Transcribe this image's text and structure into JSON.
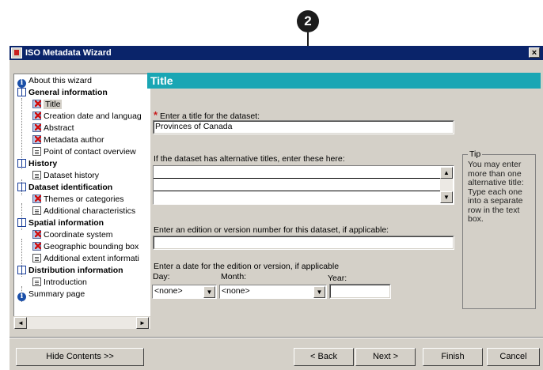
{
  "callout": {
    "number": "2"
  },
  "window": {
    "title": "ISO Metadata Wizard",
    "close_glyph": "×"
  },
  "tree": {
    "items": [
      {
        "label": "About this wizard",
        "level": 0,
        "icon": "info-icon"
      },
      {
        "label": "General information",
        "level": 0,
        "icon": "book-icon"
      },
      {
        "label": "Title",
        "level": 1,
        "icon": "required-page-icon",
        "selected": true
      },
      {
        "label": "Creation date and languag",
        "level": 1,
        "icon": "required-page-icon"
      },
      {
        "label": "Abstract",
        "level": 1,
        "icon": "required-page-icon"
      },
      {
        "label": "Metadata author",
        "level": 1,
        "icon": "required-page-icon"
      },
      {
        "label": "Point of contact overview",
        "level": 1,
        "icon": "page-icon"
      },
      {
        "label": "History",
        "level": 0,
        "icon": "book-icon"
      },
      {
        "label": "Dataset history",
        "level": 1,
        "icon": "page-icon"
      },
      {
        "label": "Dataset identification",
        "level": 0,
        "icon": "book-icon"
      },
      {
        "label": "Themes or categories",
        "level": 1,
        "icon": "required-page-icon"
      },
      {
        "label": "Additional characteristics",
        "level": 1,
        "icon": "page-icon"
      },
      {
        "label": "Spatial information",
        "level": 0,
        "icon": "book-icon"
      },
      {
        "label": "Coordinate system",
        "level": 1,
        "icon": "required-page-icon"
      },
      {
        "label": "Geographic bounding box",
        "level": 1,
        "icon": "required-page-icon"
      },
      {
        "label": "Additional extent informati",
        "level": 1,
        "icon": "page-icon"
      },
      {
        "label": "Distribution information",
        "level": 0,
        "icon": "book-icon"
      },
      {
        "label": "Introduction",
        "level": 1,
        "icon": "page-icon"
      },
      {
        "label": "Summary page",
        "level": 0,
        "icon": "info-icon"
      }
    ],
    "scroll_left": "◄",
    "scroll_right": "►"
  },
  "page": {
    "header": "Title",
    "title_label": "Enter a title for the dataset:",
    "required_mark": "*",
    "title_value": "Provinces of Canada",
    "alt_titles_label": "If the dataset has alternative titles, enter these here:",
    "scroll_up": "▲",
    "scroll_down": "▼",
    "edition_label": "Enter an edition or version number for this dataset, if applicable:",
    "edition_value": "",
    "date_label": "Enter a date for the edition or version, if applicable",
    "day_label": "Day:",
    "month_label": "Month:",
    "year_label": "Year:",
    "day_value": "<none>",
    "month_value": "<none>",
    "year_value": "",
    "combo_arrow": "▼"
  },
  "tip": {
    "title": "Tip",
    "text": "You may enter more than one alternative title: Type each one into a separate row in the text box."
  },
  "buttons": {
    "hide_contents": "Hide Contents >>",
    "back": "< Back",
    "next": "Next >",
    "finish": "Finish",
    "cancel": "Cancel"
  }
}
